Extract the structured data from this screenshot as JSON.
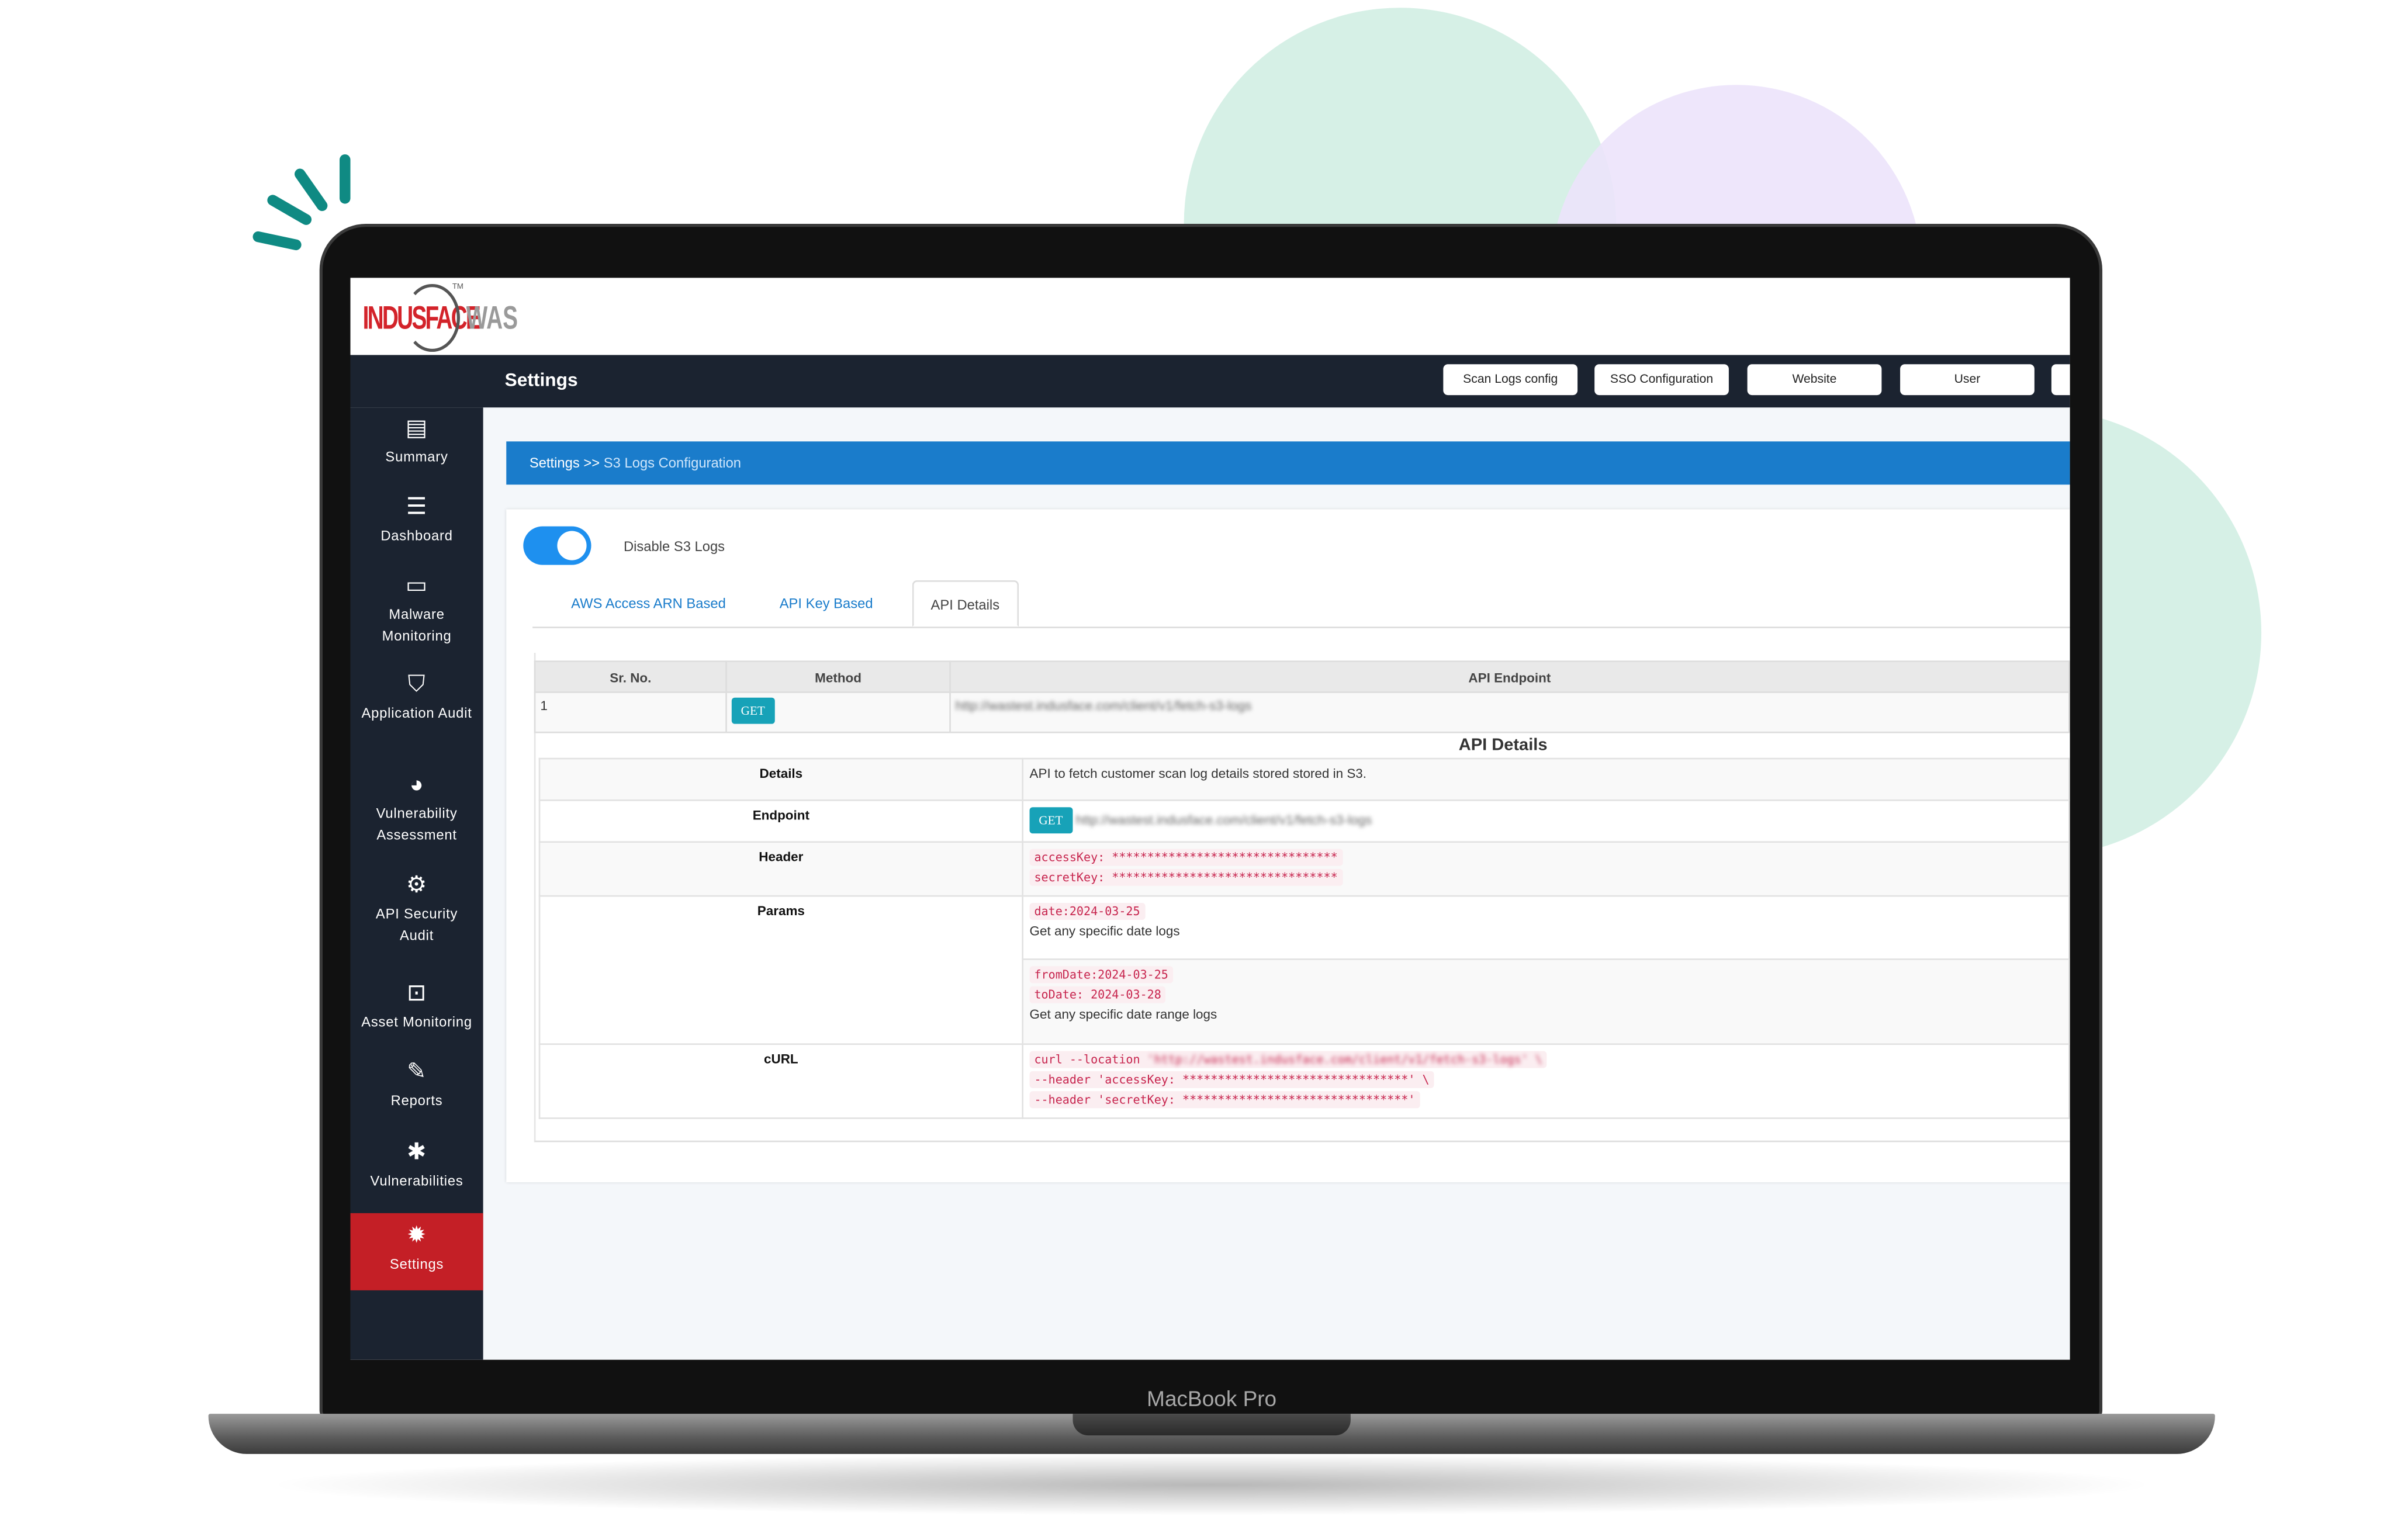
{
  "decor": {
    "green": "#d6f0e6",
    "purple": "#ece3fb",
    "accent_strokes": "#0f8a83"
  },
  "device": {
    "label": "MacBook Pro"
  },
  "logo": {
    "brand": "INDUSFACE",
    "product": "WAS",
    "tm": "TM"
  },
  "header": {
    "title": "Settings",
    "buttons": [
      "Scan Logs config",
      "SSO Configuration",
      "Website",
      "User",
      ""
    ]
  },
  "sidebar": {
    "items": [
      {
        "label": "Summary",
        "icon": "tablet-chart-icon"
      },
      {
        "label": "Dashboard",
        "icon": "server-icon"
      },
      {
        "label": "Malware Monitoring",
        "icon": "laptop-icon"
      },
      {
        "label": "Application Audit",
        "icon": "shield-icon"
      },
      {
        "label": "Vulnerability Assessment",
        "icon": "pie-chart-icon"
      },
      {
        "label": "API Security Audit",
        "icon": "api-chip-icon"
      },
      {
        "label": "Asset Monitoring",
        "icon": "asset-frame-icon"
      },
      {
        "label": "Reports",
        "icon": "edit-icon"
      },
      {
        "label": "Vulnerabilities",
        "icon": "bug-icon"
      },
      {
        "label": "Settings",
        "icon": "gear-icon",
        "active": true
      }
    ],
    "active_color": "#c41f26"
  },
  "breadcrumb": {
    "root": "Settings >>",
    "current": "S3 Logs Configuration"
  },
  "toggle": {
    "label": "Disable S3 Logs",
    "on": true,
    "color": "#1e90ef"
  },
  "tabs": [
    {
      "label": "AWS Access ARN Based"
    },
    {
      "label": "API Key Based"
    },
    {
      "label": "API Details",
      "active": true
    }
  ],
  "endpoints": {
    "columns": [
      "Sr. No.",
      "Method",
      "API Endpoint"
    ],
    "rows": [
      {
        "sr": "1",
        "method": "GET",
        "url": "http://wastest.indusface.com/client/v1/fetch-s3-logs"
      }
    ]
  },
  "api_details": {
    "title": "API Details",
    "details_label": "Details",
    "details": "API to fetch customer scan log details stored stored in S3.",
    "endpoint_label": "Endpoint",
    "endpoint_method": "GET",
    "endpoint_url": "http://wastest.indusface.com/client/v1/fetch-s3-logs",
    "header_label": "Header",
    "header_lines": [
      "accessKey: ********************************",
      "secretKey: ********************************"
    ],
    "params_label": "Params",
    "param1_code": "date:2024-03-25",
    "param1_desc": "Get any specific date logs",
    "param2_code1": "fromDate:2024-03-25",
    "param2_code2": "toDate: 2024-03-28",
    "param2_desc": "Get any specific date range logs",
    "curl_label": "cURL",
    "curl_prefix": "curl --location ",
    "curl_url": "'http://wastest.indusface.com/client/v1/fetch-s3-logs' \\",
    "curl_lines": [
      "--header 'accessKey: ********************************' \\",
      "--header 'secretKey: ********************************'"
    ]
  }
}
